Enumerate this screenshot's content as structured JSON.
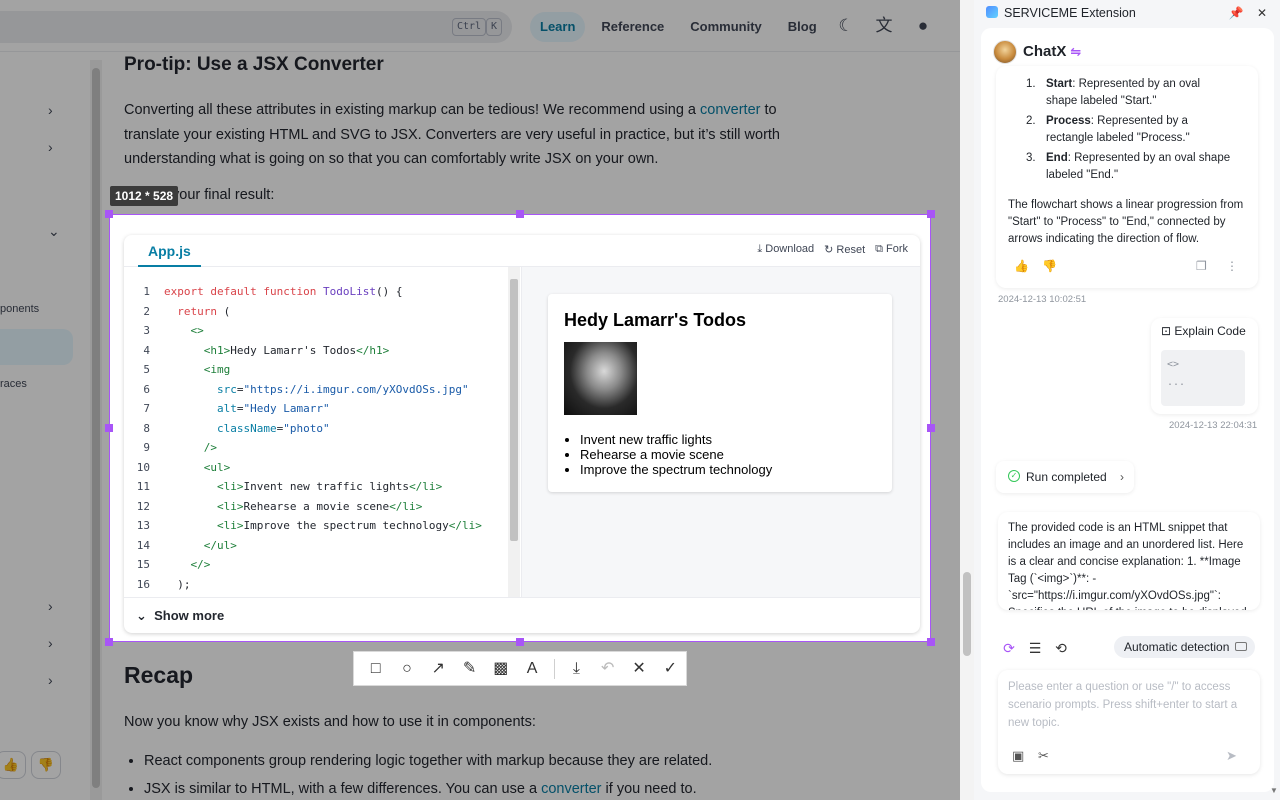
{
  "docs": {
    "search": {
      "kbd1": "Ctrl",
      "kbd2": "K"
    },
    "nav": [
      "Learn",
      "Reference",
      "Community",
      "Blog"
    ],
    "sidebar_texts": [
      "ponents",
      "races"
    ],
    "pro_tip_title": "Pro-tip: Use a JSX Converter",
    "pro_tip_p1_a": "Converting all these attributes in existing markup can be tedious! We recommend using a ",
    "pro_tip_link": "converter",
    "pro_tip_p1_b": " to translate your existing HTML and SVG to JSX. Converters are very useful in practice, but it’s still worth understanding what is going on so that you can comfortably write JSX on your own.",
    "final_result_text": "your final result:",
    "recap_title": "Recap",
    "recap_intro": "Now you know why JSX exists and how to use it in components:",
    "recap_b1": "React components group rendering logic together with markup because they are related.",
    "recap_b2_a": "JSX is similar to HTML, with a few differences. You can use a ",
    "recap_b2_link": "converter",
    "recap_b2_b": " if you need to."
  },
  "capture": {
    "size_label": "1012 * 528",
    "toolbar": [
      "rectangle-icon",
      "circle-icon",
      "arrow-icon",
      "pen-icon",
      "mosaic-icon",
      "text-icon",
      "download-icon",
      "undo-icon",
      "close-icon",
      "confirm-icon"
    ]
  },
  "sandpack": {
    "file_tab": "App.js",
    "download_label": "Download",
    "reset_label": "Reset",
    "fork_label": "Fork",
    "show_more": "Show more",
    "code_lines": [
      "export default function TodoList() {",
      "  return (",
      "    <>",
      "      <h1>Hedy Lamarr's Todos</h1>",
      "      <img",
      "        src=\"https://i.imgur.com/yXOvdOSs.jpg\"",
      "        alt=\"Hedy Lamarr\"",
      "        className=\"photo\"",
      "      />",
      "      <ul>",
      "        <li>Invent new traffic lights</li>",
      "        <li>Rehearse a movie scene</li>",
      "        <li>Improve the spectrum technology</li>",
      "      </ul>",
      "    </>",
      "  );"
    ],
    "preview": {
      "title": "Hedy Lamarr's Todos",
      "items": [
        "Invent new traffic lights",
        "Rehearse a movie scene",
        "Improve the spectrum technology"
      ]
    }
  },
  "extension": {
    "title": "SERVICEME Extension",
    "chat_name": "ChatX",
    "list": [
      {
        "num": "1.",
        "bold": "Start",
        "rest": ": Represented by an oval shape labeled \"Start.\""
      },
      {
        "num": "2.",
        "bold": "Process",
        "rest": ": Represented by a rectangle labeled \"Process.\""
      },
      {
        "num": "3.",
        "bold": "End",
        "rest": ": Represented by an oval shape labeled \"End.\""
      }
    ],
    "summary": "The flowchart shows a linear progression from \"Start\" to \"Process\" to \"End,\" connected by arrows indicating the direction of flow.",
    "ts1": "2024-12-13 10:02:51",
    "user_action": "Explain Code",
    "user_code_1": "<>",
    "user_code_2": "...",
    "ts2": "2024-12-13 22:04:31",
    "run_status": "Run completed",
    "answer": "The provided code is an HTML snippet that includes an image and an unordered list. Here is a clear and concise explanation: 1. **Image Tag (`<img>`)**: - `src=\"https://i.imgur.com/yXOvdOSs.jpg\"`: Specifies the URL of the image to be displayed",
    "detect_label": "Automatic detection",
    "input_placeholder": "Please enter a question or use \"/\" to access scenario prompts. Press shift+enter to start a new topic."
  }
}
